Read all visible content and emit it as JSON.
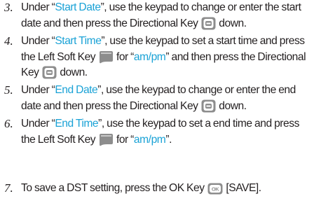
{
  "steps": [
    {
      "number": "3.",
      "text_a": "Under “",
      "field": "Start Date",
      "text_b": "”, use the keypad to change or enter the start date and then press the Directional Key",
      "icon_a": "directional-key-icon",
      "text_c": "down."
    },
    {
      "number": "4.",
      "text_a": "Under “",
      "field": "Start Time",
      "text_b": "”, use the keypad to set a start time and press the Left Soft Key",
      "icon_a": "left-soft-key-icon",
      "text_c": "for “",
      "ampm": "am/pm",
      "text_d": "” and then press the Directional Key",
      "icon_b": "directional-key-icon",
      "text_e": "down."
    },
    {
      "number": "5.",
      "text_a": "Under “",
      "field": "End Date",
      "text_b": "”, use the keypad to change or enter the end date and then press the Directional Key",
      "icon_a": "directional-key-icon",
      "text_c": "down."
    },
    {
      "number": "6.",
      "text_a": "Under “",
      "field": "End Time",
      "text_b": "”, use the keypad to set a end time and press the Left Soft Key",
      "icon_a": "left-soft-key-icon",
      "text_c": "for “",
      "ampm": "am/pm",
      "text_d": "”."
    },
    {
      "number": "7.",
      "text_a": "To save a DST setting, press the OK Key",
      "icon_a": "ok-key-icon",
      "ok_label": "OK",
      "text_b": "[SAVE]."
    }
  ],
  "colors": {
    "highlight": "#1aa2d6",
    "text": "#231f20",
    "key_fill": "#8d8d8d",
    "key_light": "#c8c8c8"
  }
}
